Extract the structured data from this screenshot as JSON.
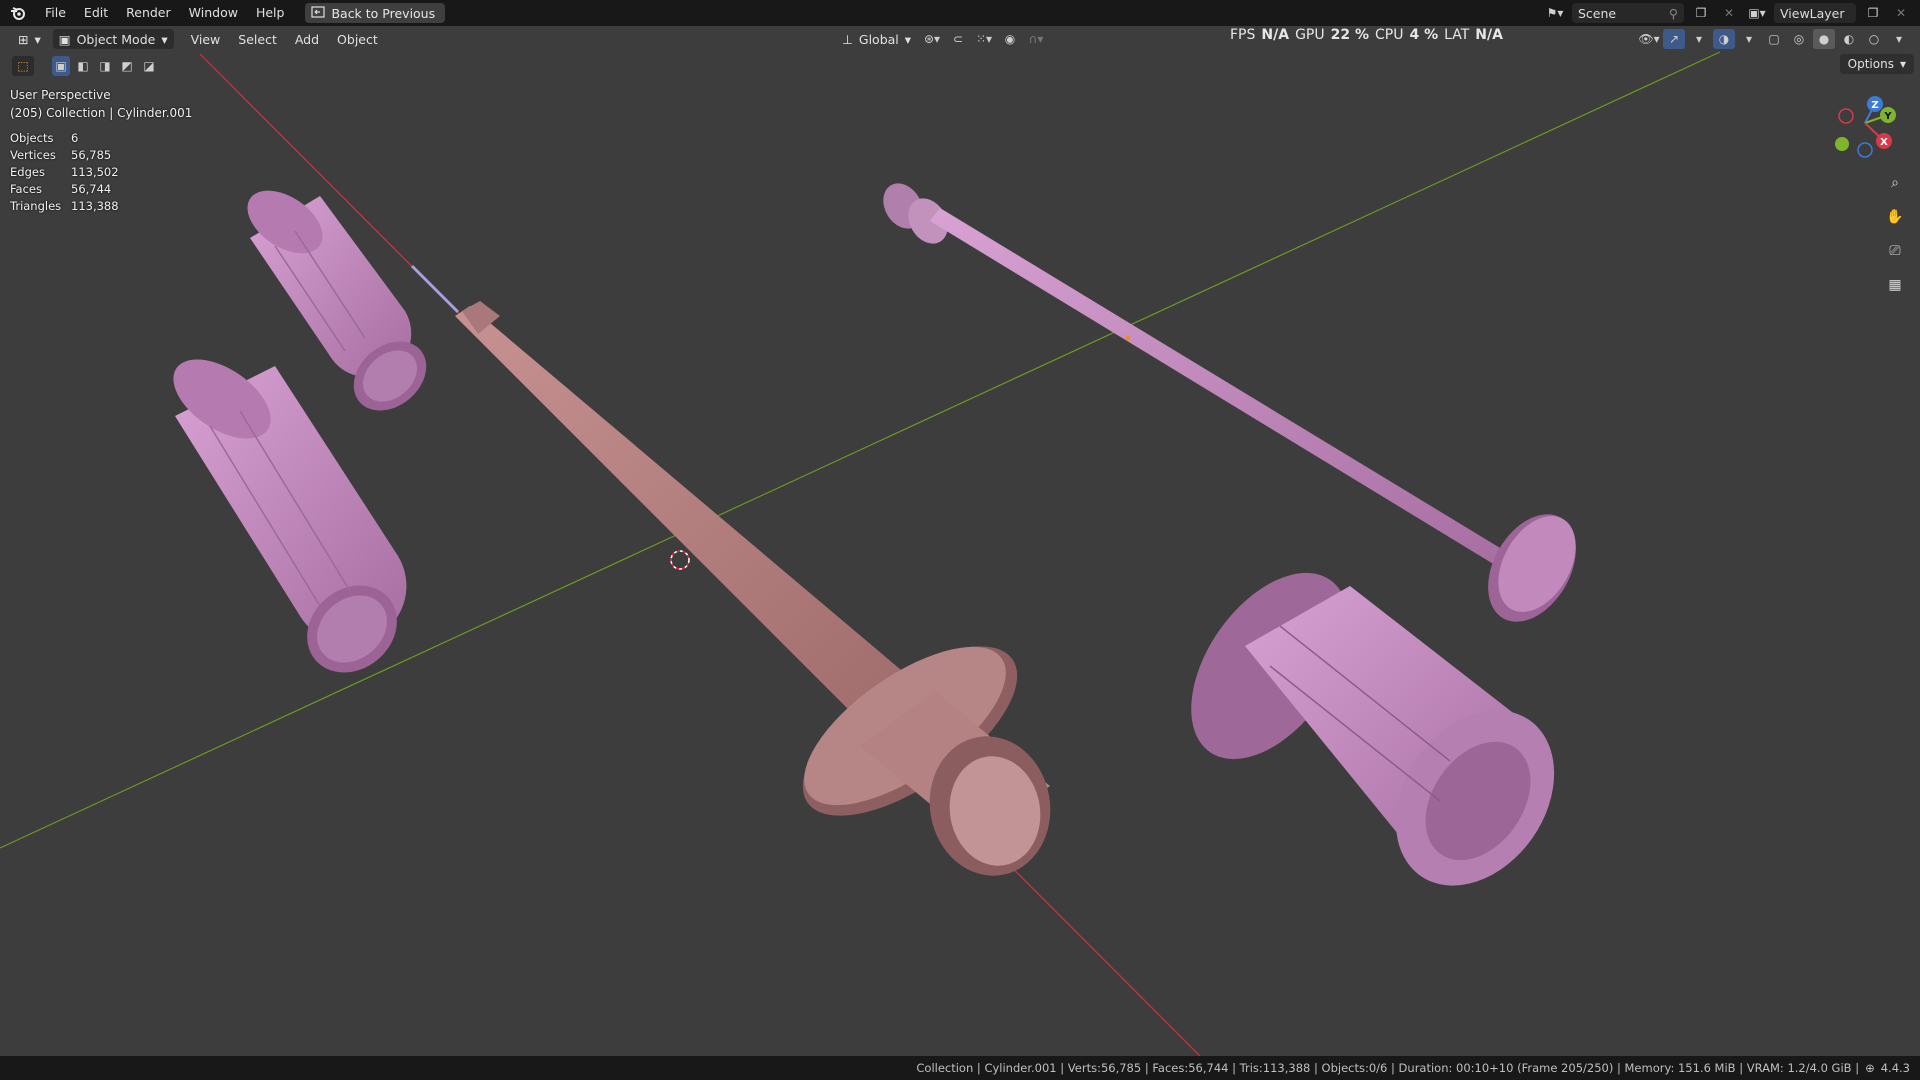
{
  "topbar": {
    "menus": [
      "File",
      "Edit",
      "Render",
      "Window",
      "Help"
    ],
    "back_button": "Back to Previous",
    "scene": "Scene",
    "view_layer": "ViewLayer"
  },
  "header": {
    "mode": "Object Mode",
    "menus": [
      "View",
      "Select",
      "Add",
      "Object"
    ],
    "orientation": "Global",
    "options_label": "Options"
  },
  "perf": {
    "fps_label": "FPS",
    "fps_value": "N/A",
    "gpu_label": "GPU",
    "gpu_value": "22 %",
    "cpu_label": "CPU",
    "cpu_value": "4 %",
    "lat_label": "LAT",
    "lat_value": "N/A"
  },
  "viewport_info": {
    "perspective": "User Perspective",
    "collection": "(205) Collection | Cylinder.001"
  },
  "stats": [
    {
      "label": "Objects",
      "value": "6"
    },
    {
      "label": "Vertices",
      "value": "56,785"
    },
    {
      "label": "Edges",
      "value": "113,502"
    },
    {
      "label": "Faces",
      "value": "56,744"
    },
    {
      "label": "Triangles",
      "value": "113,388"
    }
  ],
  "gizmo": {
    "x": "X",
    "y": "Y",
    "z": "Z"
  },
  "statusbar": {
    "text": "Collection | Cylinder.001 | Verts:56,785 | Faces:56,744 | Tris:113,388 | Objects:0/6 | Duration: 00:10+10 (Frame 205/250) | Memory: 151.6 MiB | VRAM: 1.2/4.0 GiB |",
    "version": "4.4.3"
  },
  "colors": {
    "viewport_bg": "#3d3d3d",
    "x_axis": "#c0393f",
    "y_axis": "#6a9a23",
    "barrel": "#b98080",
    "plunger": "#c98cc4"
  }
}
